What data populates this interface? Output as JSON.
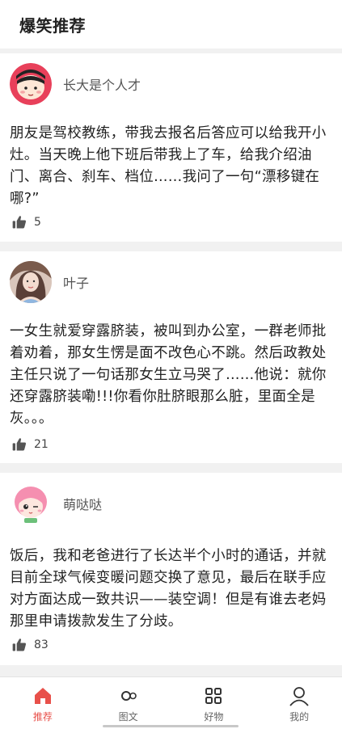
{
  "header": {
    "title": "爆笑推荐"
  },
  "posts": [
    {
      "author": "长大是个人才",
      "text": "朋友是驾校教练，带我去报名后答应可以给我开小灶。当天晚上他下班后带我上了车，给我介绍油门、离合、刹车、档位……我问了一句“漂移键在哪?”",
      "likes": "5"
    },
    {
      "author": "叶子",
      "text": "一女生就爱穿露脐装，被叫到办公室，一群老师批着劝着，那女生愣是面不改色心不跳。然后政教处主任只说了一句话那女生立马哭了……他说：就你还穿露脐装嘞!!!你看你肚脐眼那么脏，里面全是灰。。。",
      "likes": "21"
    },
    {
      "author": "萌哒哒",
      "text": "饭后，我和老爸进行了长达半个小时的通话，并就目前全球气候变暖问题交换了意见，最后在联手应对方面达成一致共识——装空调！但是有谁去老妈那里申请拨款发生了分歧。",
      "likes": "83"
    }
  ],
  "tabbar": {
    "items": [
      {
        "label": "推荐",
        "icon": "home-icon"
      },
      {
        "label": "图文",
        "icon": "image-text-icon"
      },
      {
        "label": "好物",
        "icon": "grid-icon"
      },
      {
        "label": "我的",
        "icon": "user-icon"
      }
    ],
    "active_color": "#e8504a",
    "inactive_color": "#666666"
  }
}
